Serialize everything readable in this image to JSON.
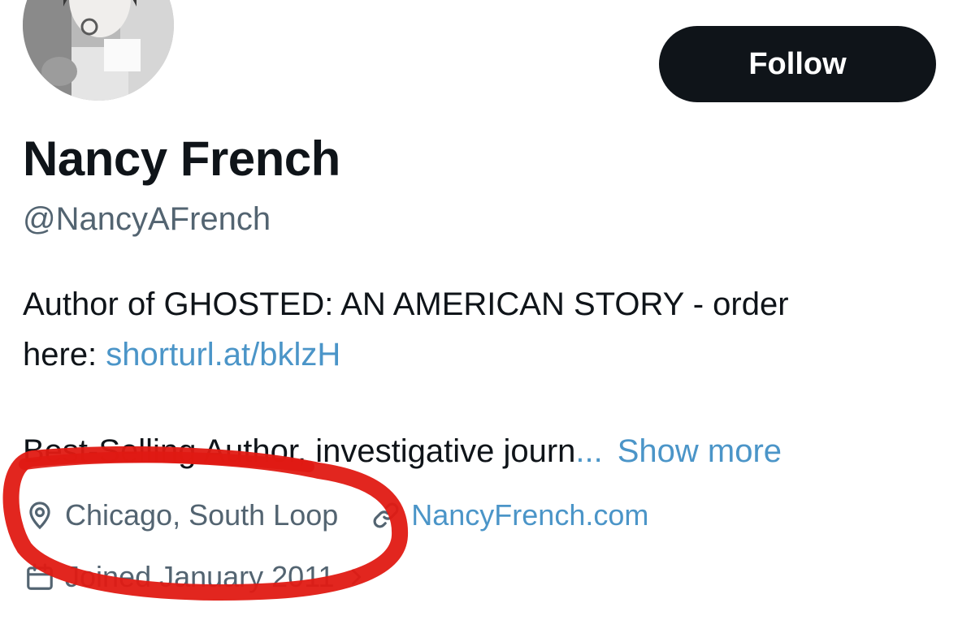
{
  "profile": {
    "display_name": "Nancy French",
    "handle": "@NancyAFrench",
    "follow_label": "Follow"
  },
  "bio": {
    "line1": "Author of GHOSTED: AN AMERICAN STORY - order",
    "line2_prefix": "here: ",
    "link_text": "shorturl.at/bklzH",
    "line3_text": "Best-Selling Author, investigative journ",
    "ellipsis": "...",
    "show_more": "Show more"
  },
  "meta": {
    "location": "Chicago, South Loop",
    "website": "NancyFrench.com",
    "joined": "Joined January 2011"
  },
  "colors": {
    "accent_link": "#4b95c8",
    "text_primary": "#0f1419",
    "text_secondary": "#536471",
    "button_bg": "#0f1419",
    "annotation_red": "#e01a13"
  },
  "icons": {
    "location": "location-pin-icon",
    "website": "link-icon",
    "joined": "calendar-icon",
    "joined_chevron": "chevron-right-icon"
  }
}
